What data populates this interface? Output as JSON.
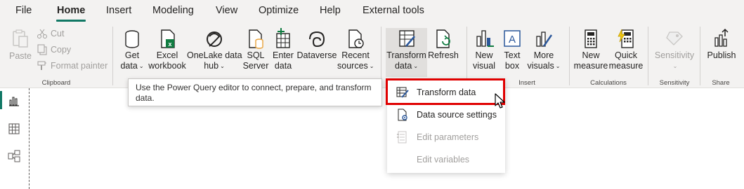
{
  "menu": {
    "tabs": [
      {
        "label": "File"
      },
      {
        "label": "Home"
      },
      {
        "label": "Insert"
      },
      {
        "label": "Modeling"
      },
      {
        "label": "View"
      },
      {
        "label": "Optimize"
      },
      {
        "label": "Help"
      },
      {
        "label": "External tools"
      }
    ],
    "active_tab": "Home"
  },
  "ribbon": {
    "clipboard": {
      "paste": "Paste",
      "cut": "Cut",
      "copy": "Copy",
      "format_painter": "Format painter",
      "group_label": "Clipboard"
    },
    "data": {
      "get_data": [
        "Get",
        "data"
      ],
      "excel": [
        "Excel",
        "workbook"
      ],
      "onelake": [
        "OneLake data",
        "hub"
      ],
      "sql": [
        "SQL",
        "Server"
      ],
      "enter_data": [
        "Enter",
        "data"
      ],
      "dataverse": [
        "Dataverse"
      ],
      "recent": [
        "Recent",
        "sources"
      ]
    },
    "queries": {
      "transform": [
        "Transform",
        "data"
      ],
      "refresh": [
        "Refresh"
      ]
    },
    "insert": {
      "new_visual": [
        "New",
        "visual"
      ],
      "text_box": [
        "Text",
        "box"
      ],
      "more_visuals": [
        "More",
        "visuals"
      ],
      "group_label": "Insert"
    },
    "calculations": {
      "new_measure": [
        "New",
        "measure"
      ],
      "quick_measure": [
        "Quick",
        "measure"
      ],
      "group_label": "Calculations"
    },
    "sensitivity": {
      "label": "Sensitivity",
      "group_label": "Sensitivity"
    },
    "share": {
      "publish": "Publish",
      "group_label": "Share"
    }
  },
  "tooltip": {
    "text": "Use the Power Query editor to connect, prepare, and transform data."
  },
  "dropdown": {
    "items": [
      {
        "label": "Transform data",
        "icon": "transform-data-icon",
        "enabled": true
      },
      {
        "label": "Data source settings",
        "icon": "data-source-settings-icon",
        "enabled": true
      },
      {
        "label": "Edit parameters",
        "icon": "edit-parameters-icon",
        "enabled": false
      },
      {
        "label": "Edit variables",
        "icon": "edit-variables-icon",
        "enabled": false
      }
    ]
  },
  "sidebar": {
    "items": [
      {
        "name": "report-view-icon"
      },
      {
        "name": "table-view-icon"
      },
      {
        "name": "model-view-icon"
      }
    ]
  },
  "colors": {
    "accent": "#117865",
    "highlight_border": "#e00000",
    "ribbon_bg": "#f3f2f1",
    "disabled_text": "#a19f9d"
  }
}
